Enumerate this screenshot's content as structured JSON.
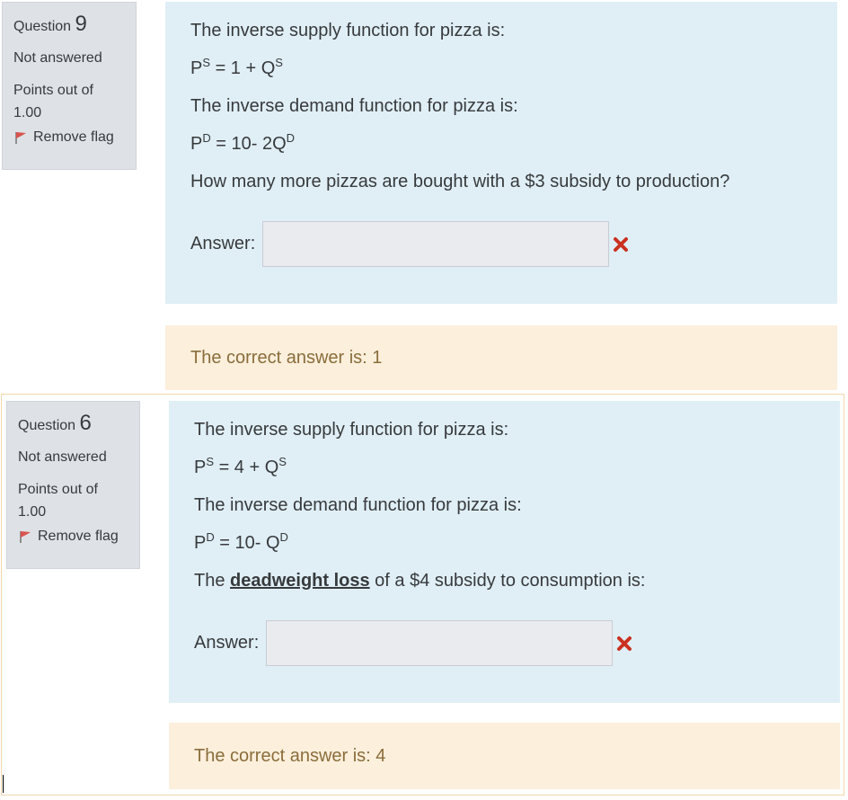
{
  "questions": [
    {
      "label": "Question",
      "number": "9",
      "status": "Not answered",
      "points_line1": "Points out of",
      "points_line2": "1.00",
      "flag_label": "Remove flag",
      "supply_intro": "The inverse supply function for pizza is:",
      "supply_lhs": "P",
      "supply_lhs_sup": "S",
      "supply_mid": " = 1 + Q",
      "supply_rhs_sup": "S",
      "demand_intro": "The inverse demand function for pizza is:",
      "demand_lhs": "P",
      "demand_lhs_sup": "D",
      "demand_mid": " = 10- 2Q",
      "demand_rhs_sup": "D",
      "prompt": "How many more pizzas are bought with a $3 subsidy to production?",
      "answer_label": "Answer:",
      "answer_value": "",
      "feedback": "The correct answer is: 1"
    },
    {
      "label": "Question",
      "number": "6",
      "status": "Not answered",
      "points_line1": "Points out of",
      "points_line2": "1.00",
      "flag_label": "Remove flag",
      "supply_intro": "The inverse supply function for pizza is:",
      "supply_lhs": "P",
      "supply_lhs_sup": "S",
      "supply_mid": " = 4 + Q",
      "supply_rhs_sup": "S",
      "demand_intro": "The inverse demand function for pizza is:",
      "demand_lhs": "P",
      "demand_lhs_sup": "D",
      "demand_mid": " = 10- Q",
      "demand_rhs_sup": "D",
      "prompt_before": "The ",
      "prompt_link": "deadweight loss",
      "prompt_after": " of a $4 subsidy to consumption is:",
      "answer_label": "Answer:",
      "answer_value": "",
      "feedback": "The correct answer is: 4"
    }
  ],
  "colors": {
    "info_bg": "#dee2e6",
    "content_bg": "#e0eff6",
    "feedback_bg": "#fcefdc",
    "feedback_text": "#8a6d3b",
    "incorrect_icon": "#ca3120",
    "flag_icon": "#d9534f"
  },
  "icons": {
    "flag": "flag-icon",
    "incorrect": "incorrect-x-icon"
  }
}
